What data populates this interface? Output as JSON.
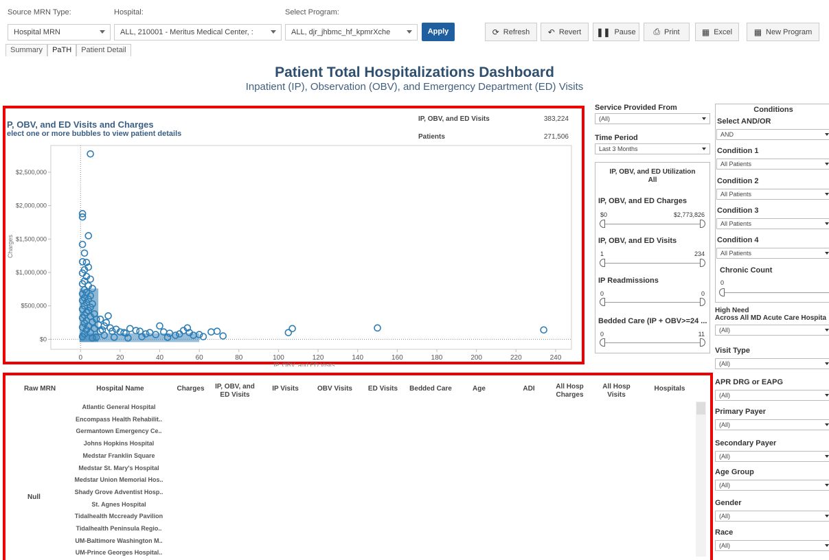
{
  "toolbar": {
    "source_mrn_label": "Source MRN Type:",
    "source_mrn_value": "Hospital MRN",
    "hospital_label": "Hospital:",
    "hospital_value": "ALL, 210001 - Meritus Medical Center, :",
    "program_label": "Select Program:",
    "program_value": "ALL, djr_jhbmc_hf_kpmrXche",
    "apply": "Apply",
    "refresh": "Refresh",
    "revert": "Revert",
    "pause": "Pause",
    "print": "Print",
    "excel": "Excel",
    "new_program": "New Program"
  },
  "tabs": [
    "Summary",
    "PaTH",
    "Patient Detail"
  ],
  "dashboard": {
    "title": "Patient Total Hospitalizations Dashboard",
    "subtitle": "Inpatient (IP), Observation (OBV), and Emergency Department (ED) Visits"
  },
  "chart_header": {
    "title": "P, OBV, and ED Visits and Charges",
    "subtitle": "elect one or more bubbles to view patient details",
    "kpi1_label": "IP, OBV, and ED Visits",
    "kpi1_value": "383,224",
    "kpi2_label": "Patients",
    "kpi2_value": "271,506"
  },
  "chart_data": {
    "type": "scatter",
    "xlabel": "IP, OBV, and ED Visits",
    "ylabel": "Charges",
    "xlim": [
      -15,
      248
    ],
    "ylim": [
      -150000,
      2900000
    ],
    "x_ticks": [
      0,
      20,
      40,
      60,
      80,
      100,
      120,
      140,
      160,
      180,
      200,
      220,
      240
    ],
    "y_ticks": [
      0,
      500000,
      1000000,
      1500000,
      2000000,
      2500000
    ],
    "y_tick_labels": [
      "$0",
      "$500,000",
      "$1,000,000",
      "$1,500,000",
      "$2,000,000",
      "$2,500,000"
    ],
    "marker_color": "#2e7db5",
    "points": [
      [
        5,
        2773826
      ],
      [
        1,
        1880000
      ],
      [
        1,
        1830000
      ],
      [
        4,
        1550000
      ],
      [
        1,
        1420000
      ],
      [
        2,
        1290000
      ],
      [
        1,
        1160000
      ],
      [
        3,
        1150000
      ],
      [
        4,
        1080000
      ],
      [
        2,
        1040000
      ],
      [
        1,
        990000
      ],
      [
        3,
        940000
      ],
      [
        5,
        900000
      ],
      [
        2,
        870000
      ],
      [
        1,
        830000
      ],
      [
        4,
        800000
      ],
      [
        6,
        760000
      ],
      [
        2,
        740000
      ],
      [
        3,
        700000
      ],
      [
        1,
        680000
      ],
      [
        5,
        650000
      ],
      [
        2,
        620000
      ],
      [
        4,
        600000
      ],
      [
        1,
        580000
      ],
      [
        3,
        550000
      ],
      [
        6,
        530000
      ],
      [
        2,
        500000
      ],
      [
        5,
        480000
      ],
      [
        1,
        450000
      ],
      [
        4,
        430000
      ],
      [
        3,
        400000
      ],
      [
        7,
        380000
      ],
      [
        2,
        360000
      ],
      [
        5,
        340000
      ],
      [
        1,
        320000
      ],
      [
        8,
        300000
      ],
      [
        3,
        280000
      ],
      [
        6,
        260000
      ],
      [
        2,
        240000
      ],
      [
        9,
        220000
      ],
      [
        4,
        200000
      ],
      [
        1,
        180000
      ],
      [
        7,
        160000
      ],
      [
        3,
        140000
      ],
      [
        10,
        120000
      ],
      [
        5,
        100000
      ],
      [
        2,
        80000
      ],
      [
        12,
        60000
      ],
      [
        1,
        40000
      ],
      [
        6,
        20000
      ],
      [
        14,
        350000
      ],
      [
        10,
        300000
      ],
      [
        13,
        250000
      ],
      [
        12,
        200000
      ],
      [
        15,
        170000
      ],
      [
        18,
        150000
      ],
      [
        11,
        140000
      ],
      [
        16,
        120000
      ],
      [
        20,
        110000
      ],
      [
        22,
        100000
      ],
      [
        25,
        160000
      ],
      [
        28,
        130000
      ],
      [
        23,
        90000
      ],
      [
        30,
        120000
      ],
      [
        33,
        80000
      ],
      [
        35,
        100000
      ],
      [
        38,
        70000
      ],
      [
        40,
        200000
      ],
      [
        42,
        110000
      ],
      [
        45,
        90000
      ],
      [
        48,
        60000
      ],
      [
        50,
        80000
      ],
      [
        52,
        130000
      ],
      [
        54,
        170000
      ],
      [
        55,
        100000
      ],
      [
        57,
        60000
      ],
      [
        60,
        70000
      ],
      [
        62,
        40000
      ],
      [
        66,
        110000
      ],
      [
        69,
        120000
      ],
      [
        72,
        50000
      ],
      [
        105,
        100000
      ],
      [
        107,
        160000
      ],
      [
        150,
        170000
      ],
      [
        234,
        140000
      ],
      [
        8,
        30000
      ],
      [
        17,
        30000
      ],
      [
        24,
        20000
      ],
      [
        31,
        40000
      ],
      [
        44,
        30000
      ]
    ]
  },
  "table": {
    "headers": [
      "Raw MRN",
      "Hospital Name",
      "Charges",
      "IP, OBV, and ED Visits",
      "IP Visits",
      "OBV Visits",
      "ED Visits",
      "Bedded Care",
      "Age",
      "ADI",
      "All Hosp Charges",
      "All Hosp Visits",
      "Hospitals"
    ],
    "raw_mrn": "Null",
    "hospitals": [
      "Atlantic General Hospital",
      "Encompass Health Rehabilit..",
      "Germantown Emergency Ce..",
      "Johns Hopkins Hospital",
      "Medstar Franklin Square",
      "Medstar St. Mary's Hospital",
      "Medstar Union Memorial Hos..",
      "Shady Grove Adventist Hosp..",
      "St. Agnes Hospital",
      "Tidalhealth Mccready Pavilion",
      "Tidalhealth Peninsula Regio..",
      "UM-Baltimore Washington M..",
      "UM-Prince Georges Hospital.."
    ]
  },
  "filters": {
    "service_from_label": "Service Provided From",
    "service_from_value": "(All)",
    "time_period_label": "Time Period",
    "time_period_value": "Last 3 Months",
    "util_title": "IP, OBV, and ED Utilization",
    "util_subtitle": "All",
    "charges_label": "IP, OBV, and ED Charges",
    "charges_min": "$0",
    "charges_max": "$2,773,826",
    "visits_label": "IP, OBV, and ED Visits",
    "visits_min": "1",
    "visits_max": "234",
    "readm_label": "IP Readmissions",
    "readm_min": "0",
    "readm_max": "0",
    "bedded_label": "Bedded Care (IP + OBV>=24 ...",
    "bedded_min": "0",
    "bedded_max": "11"
  },
  "conditions": {
    "title": "Conditions",
    "andor_label": "Select AND/OR",
    "andor_value": "AND",
    "c1_label": "Condition 1",
    "c1_value": "All Patients",
    "c2_label": "Condition 2",
    "c2_value": "All Patients",
    "c3_label": "Condition 3",
    "c3_value": "All Patients",
    "c4_label": "Condition 4",
    "c4_value": "All Patients",
    "chronic_label": "Chronic Count",
    "chronic_min": "0",
    "high_need_label1": "High Need",
    "high_need_label2": "Across All MD Acute Care Hospita",
    "high_need_value": "(All)",
    "visit_type_label": "Visit Type",
    "visit_type_value": "(All)",
    "apr_label": "APR DRG or EAPG",
    "apr_value": "(All)",
    "primary_payer_label": "Primary Payer",
    "primary_payer_value": "(All)",
    "secondary_payer_label": "Secondary Payer",
    "secondary_payer_value": "(All)",
    "age_group_label": "Age Group",
    "age_group_value": "(All)",
    "gender_label": "Gender",
    "gender_value": "(All)",
    "race_label": "Race",
    "race_value": "(All)"
  }
}
